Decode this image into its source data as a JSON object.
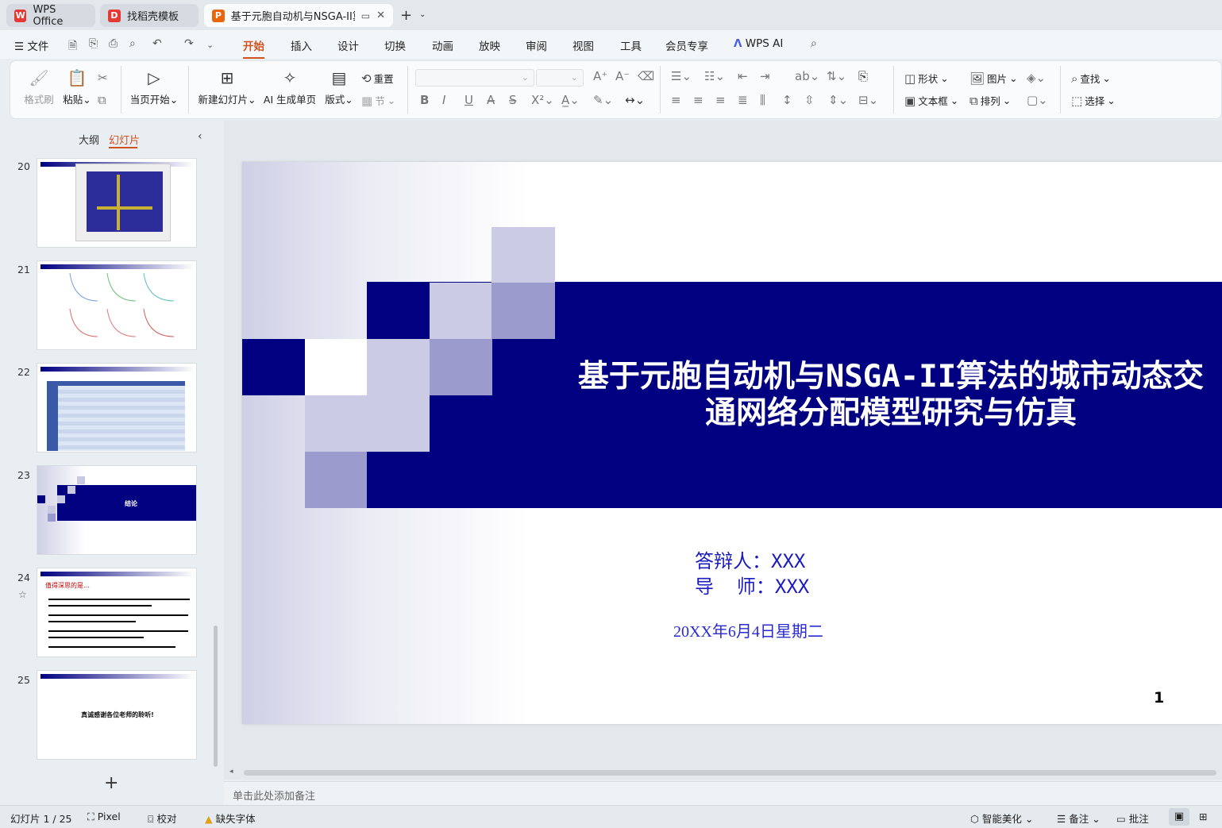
{
  "tabs": [
    {
      "label": "WPS Office",
      "logo": "W"
    },
    {
      "label": "找稻壳模板",
      "logo": "D"
    },
    {
      "label": "基于元胞自动机与NSGA-II算",
      "logo": "P"
    }
  ],
  "menu": {
    "file": "文件",
    "items": [
      "开始",
      "插入",
      "设计",
      "切换",
      "动画",
      "放映",
      "审阅",
      "视图",
      "工具",
      "会员专享"
    ],
    "ai": "WPS AI"
  },
  "ribbon": {
    "format_painter": "格式刷",
    "paste": "粘贴",
    "start_from_current": "当页开始",
    "new_slide": "新建幻灯片",
    "ai_page": "AI 生成单页",
    "layout": "版式",
    "reset": "重置",
    "section": "节",
    "shape": "形状",
    "picture": "图片",
    "textbox": "文本框",
    "arrange": "排列",
    "find": "查找",
    "select": "选择"
  },
  "sidebar": {
    "tab_outline": "大纲",
    "tab_slides": "幻灯片",
    "slide_numbers": [
      "20",
      "21",
      "22",
      "23",
      "24",
      "25"
    ],
    "thumb_23_text": "结论",
    "thumb_24_title": "值得深思的是…",
    "thumb_25_text": "真诚感谢各位老师的聆听!"
  },
  "slide": {
    "title_line1": "基于元胞自动机与NSGA-II算法的城市动态交",
    "title_line2": "通网络分配模型研究与仿真",
    "defender": "答辩人：XXX",
    "advisor": "导  师：XXX",
    "date": "20XX年6月4日星期二",
    "page": "1"
  },
  "notes_placeholder": "单击此处添加备注",
  "status": {
    "slide_count": "幻灯片 1 / 25",
    "theme": "Pixel",
    "proof": "校对",
    "missing_font": "缺失字体",
    "beautify": "智能美化",
    "notes": "备注",
    "comments": "批注"
  },
  "colors": {
    "accent": "#d2511e",
    "slide_band": "#000080",
    "text_blue": "#1c1cc0"
  }
}
